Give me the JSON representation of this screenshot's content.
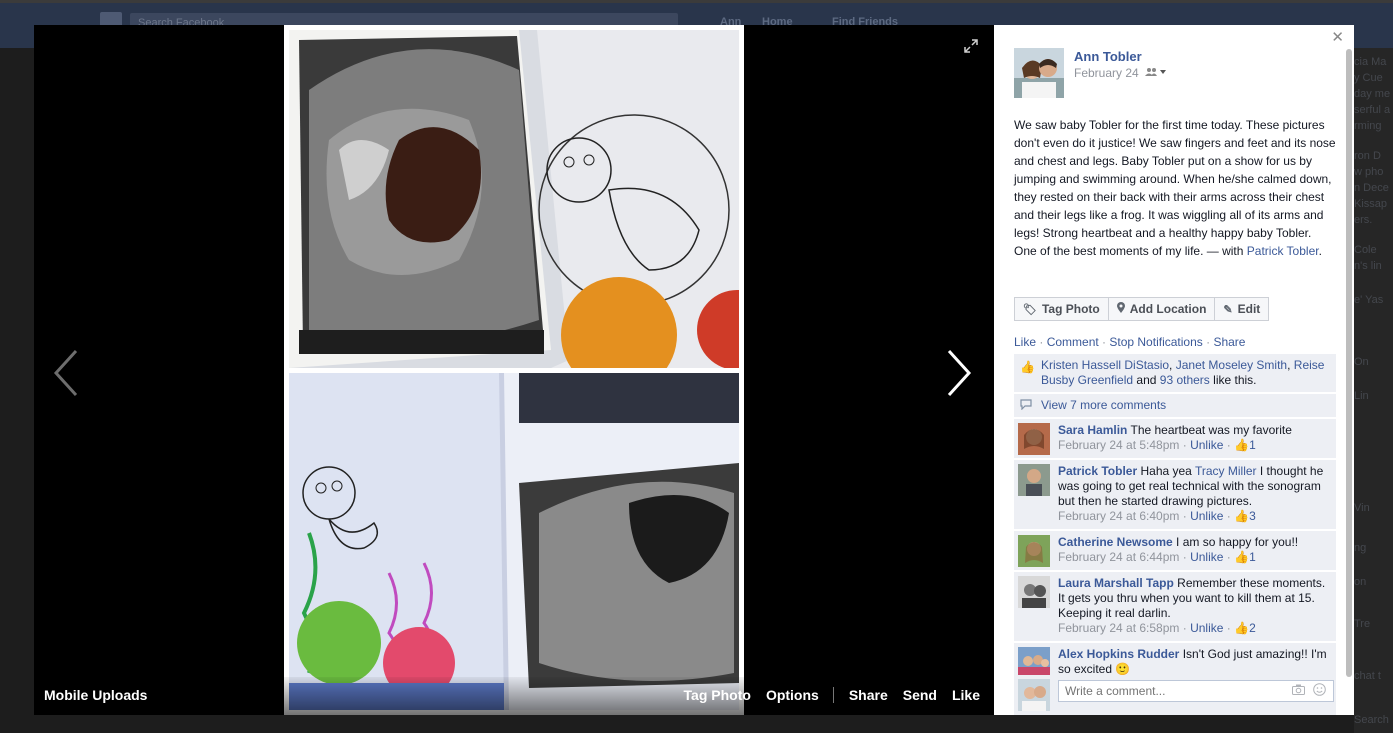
{
  "background_page": {
    "search_placeholder": "Search Facebook",
    "nav": [
      "Ann",
      "Home",
      "Find Friends"
    ],
    "right_fragments": [
      "cia Ma",
      "y Cue",
      "day me",
      "serful a",
      "rming",
      "ron D",
      "w pho",
      "n Dece",
      "Kissap",
      "ers.",
      "Cole",
      "n's lin",
      "e' Yas",
      "On",
      "Lin",
      "Vin",
      "ng",
      "on",
      "Tre",
      "chat t",
      "Search"
    ]
  },
  "stage": {
    "album_name": "Mobile Uploads",
    "actions": {
      "tag_photo": "Tag Photo",
      "options": "Options",
      "share": "Share",
      "send": "Send",
      "like": "Like"
    }
  },
  "post": {
    "author": "Ann Tobler",
    "date": "February 24",
    "text": "We saw baby Tobler for the first time today. These pictures don't even do it justice! We saw fingers and feet and its nose and chest and legs. Baby Tobler put on a show for us by jumping and swimming around. When he/she calmed down, they rested on their back with their arms across their chest and their legs like a frog. It was wiggling all of its arms and legs! Strong heartbeat and a healthy happy baby Tobler. One of the best moments of my life.",
    "with_prefix": " — with ",
    "with_person": "Patrick Tobler",
    "with_suffix": "."
  },
  "post_buttons": {
    "tag_photo": "Tag Photo",
    "add_location": "Add Location",
    "edit": "Edit"
  },
  "ufi": {
    "like": "Like",
    "comment": "Comment",
    "stop_notifications": "Stop Notifications",
    "share": "Share",
    "sep": " · "
  },
  "likes": {
    "names": [
      "Kristen Hassell DiStasio",
      "Janet Moseley Smith",
      "Reise Busby Greenfield"
    ],
    "and_text": " and ",
    "others": "93 others",
    "suffix": " like this."
  },
  "view_more": "View 7 more comments",
  "comments": [
    {
      "name": "Sara Hamlin",
      "text": "The heartbeat was my favorite",
      "time": "February 24 at 5:48pm",
      "unlike": "Unlike",
      "likes": "1"
    },
    {
      "name": "Patrick Tobler",
      "text_before": "Haha yea ",
      "mention": "Tracy Miller",
      "text_after": " I thought he was going to get real technical with the sonogram but then he started drawing pictures.",
      "time": "February 24 at 6:40pm",
      "unlike": "Unlike",
      "likes": "3"
    },
    {
      "name": "Catherine Newsome",
      "text": "I am so happy for you!!",
      "time": "February 24 at 6:44pm",
      "unlike": "Unlike",
      "likes": "1"
    },
    {
      "name": "Laura Marshall Tapp",
      "text": "Remember these moments. It gets you thru when you want to kill them at 15. Keeping it real darlin.",
      "time": "February 24 at 6:58pm",
      "unlike": "Unlike",
      "likes": "2"
    },
    {
      "name": "Alex Hopkins Rudder",
      "text": "Isn't God just amazing!! I'm so excited",
      "emoji": "🙂"
    }
  ],
  "comment_input": {
    "placeholder": "Write a comment..."
  },
  "colors": {
    "link": "#3b5998",
    "ufi_bg": "#edeff4",
    "meta": "#90949c"
  }
}
